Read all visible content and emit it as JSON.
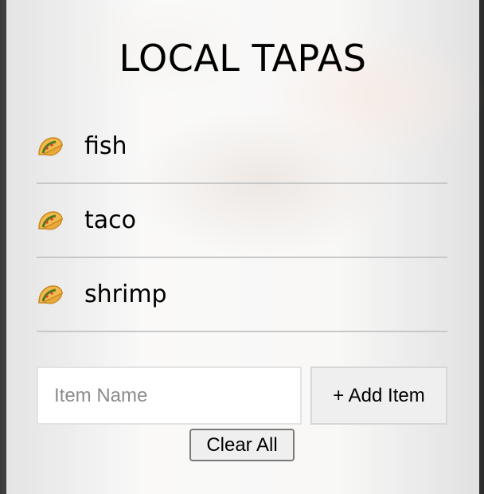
{
  "app": {
    "title": "LOCAL TAPAS"
  },
  "items": [
    {
      "label": "fish",
      "icon": "taco-icon"
    },
    {
      "label": "taco",
      "icon": "taco-icon"
    },
    {
      "label": "shrimp",
      "icon": "taco-icon"
    }
  ],
  "form": {
    "item_name_placeholder": "Item Name",
    "item_name_value": "",
    "add_label": "+ Add Item",
    "clear_label": "Clear All"
  },
  "colors": {
    "card_bg": "#ffffff",
    "divider": "#c8c8c8",
    "button_bg": "#efefef"
  }
}
